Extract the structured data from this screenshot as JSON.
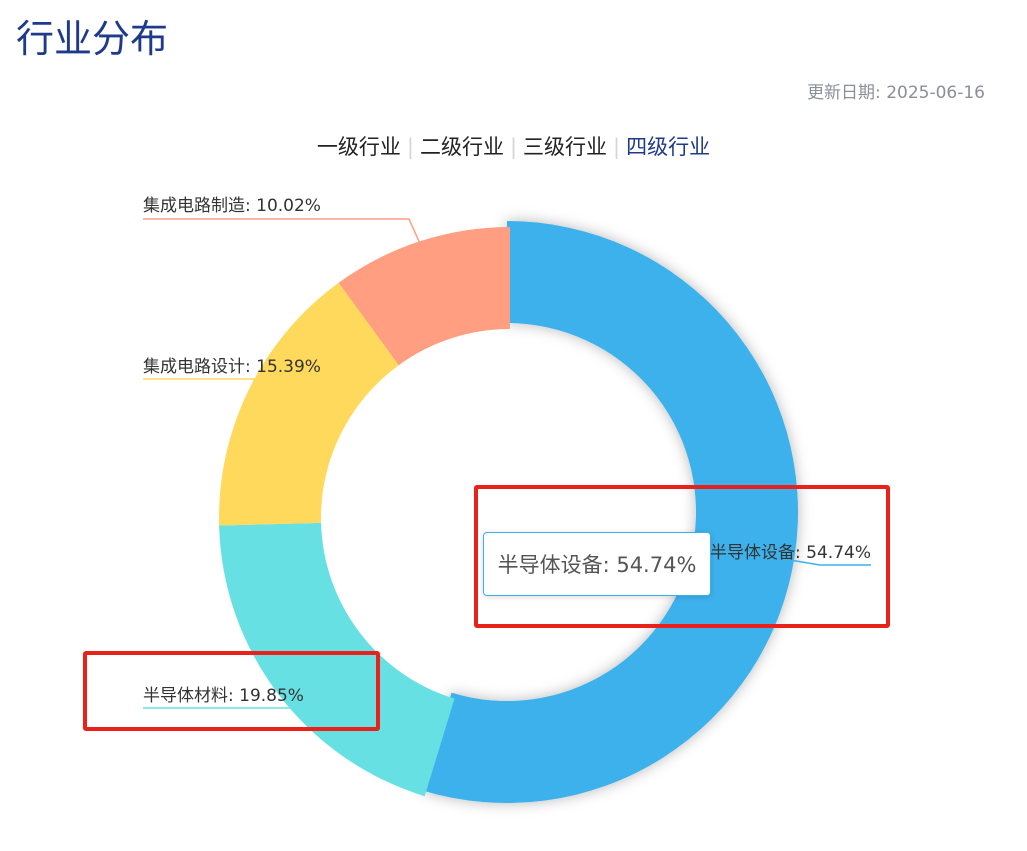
{
  "title": "行业分布",
  "update_date": "更新日期: 2025-06-16",
  "tabs": [
    {
      "label": "一级行业",
      "active": false
    },
    {
      "label": "二级行业",
      "active": false
    },
    {
      "label": "三级行业",
      "active": false
    },
    {
      "label": "四级行业",
      "active": true
    }
  ],
  "tooltip": {
    "text": "半导体设备: 54.74%"
  },
  "colors": {
    "active_tab": "#1f3a8a",
    "highlight": "#e8221b"
  },
  "chart_data": {
    "type": "pie",
    "donut": true,
    "slices": [
      {
        "name": "半导体设备",
        "value": 54.74,
        "label": "半导体设备: 54.74%",
        "color": "#3eb1ec"
      },
      {
        "name": "半导体材料",
        "value": 19.85,
        "label": "半导体材料: 19.85%",
        "color": "#66e0e3"
      },
      {
        "name": "集成电路设计",
        "value": 15.39,
        "label": "集成电路设计: 15.39%",
        "color": "#ffd95c"
      },
      {
        "name": "集成电路制造",
        "value": 10.02,
        "label": "集成电路制造: 10.02%",
        "color": "#ff9e80"
      }
    ]
  }
}
